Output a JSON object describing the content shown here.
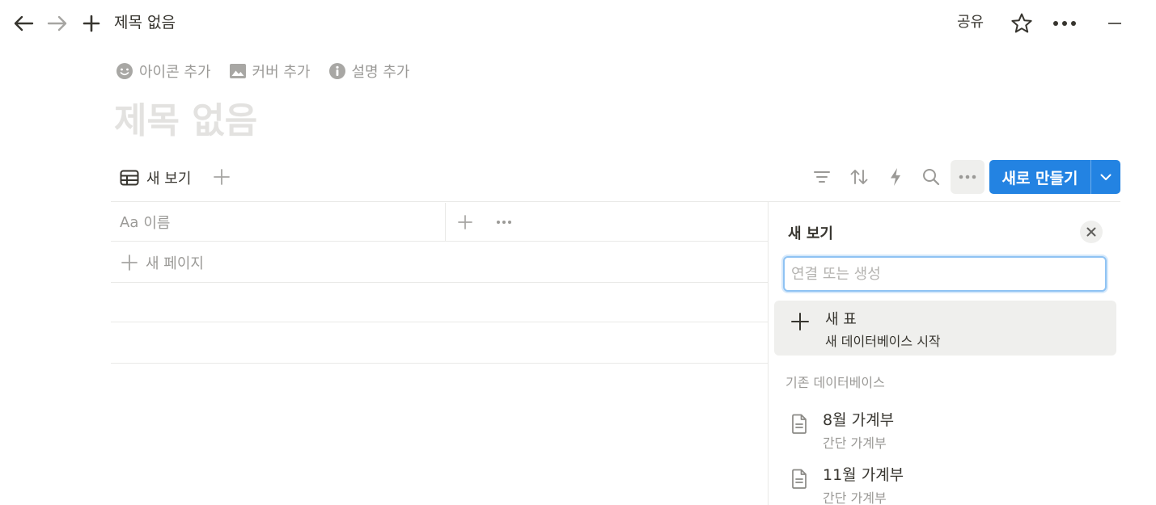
{
  "topbar": {
    "page_crumb": "제목 없음",
    "share_label": "공유"
  },
  "page_controls": {
    "add_icon": "아이콘 추가",
    "add_cover": "커버 추가",
    "add_description": "설명 추가"
  },
  "page": {
    "title": "제목 없음"
  },
  "views": {
    "active_tab": "새 보기"
  },
  "toolbar": {
    "new_button_label": "새로 만들기"
  },
  "table": {
    "name_column_prefix": "Aa",
    "name_column": "이름",
    "new_page_label": "새 페이지"
  },
  "panel": {
    "title": "새 보기",
    "search_placeholder": "연결 또는 생성",
    "new_table": {
      "title": "새 표",
      "subtitle": "새 데이터베이스 시작"
    },
    "section_label": "기존 데이터베이스",
    "databases": [
      {
        "title": "8월 가계부",
        "subtitle": "간단 가계부"
      },
      {
        "title": "11월 가계부",
        "subtitle": "간단 가계부"
      }
    ]
  },
  "colors": {
    "accent": "#2383e2",
    "text": "#37352f",
    "muted": "#9b9a97",
    "placeholder_title": "#e3e2e0",
    "divider": "#e9e9e7"
  },
  "icons": {
    "back": "arrow-left-icon",
    "forward": "arrow-right-icon",
    "new": "plus-icon",
    "favorite": "star-icon",
    "more": "ellipsis-icon",
    "minimize": "minimize-icon",
    "filter": "filter-icon",
    "sort": "sort-icon",
    "automation": "lightning-icon",
    "search": "search-icon",
    "table_view": "table-icon",
    "page": "document-icon"
  }
}
